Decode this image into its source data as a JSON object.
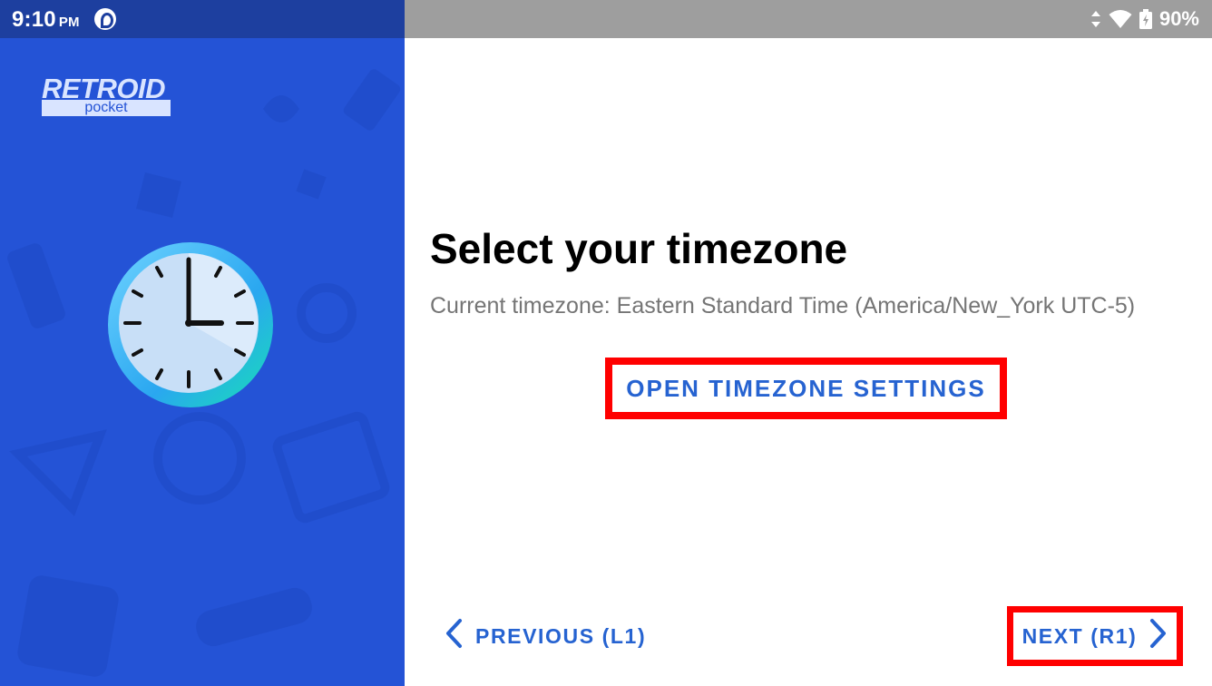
{
  "status_bar": {
    "time": "9:10",
    "ampm": "PM",
    "battery": "90%"
  },
  "brand": {
    "name": "RETROID",
    "model": "pocket"
  },
  "content": {
    "title": "Select your timezone",
    "current_timezone": "Current timezone: Eastern Standard Time (America/New_York UTC-5)",
    "open_settings_label": "OPEN TIMEZONE SETTINGS"
  },
  "nav": {
    "previous_label": "PREVIOUS (L1)",
    "next_label": "NEXT (R1)"
  },
  "icons": {
    "clock": "clock-icon",
    "wifi": "wifi-icon",
    "battery": "battery-icon",
    "data": "data-arrows-icon"
  },
  "colors": {
    "left_panel": "#2453d6",
    "accent": "#2663d1",
    "highlight_border": "#ff0000"
  }
}
